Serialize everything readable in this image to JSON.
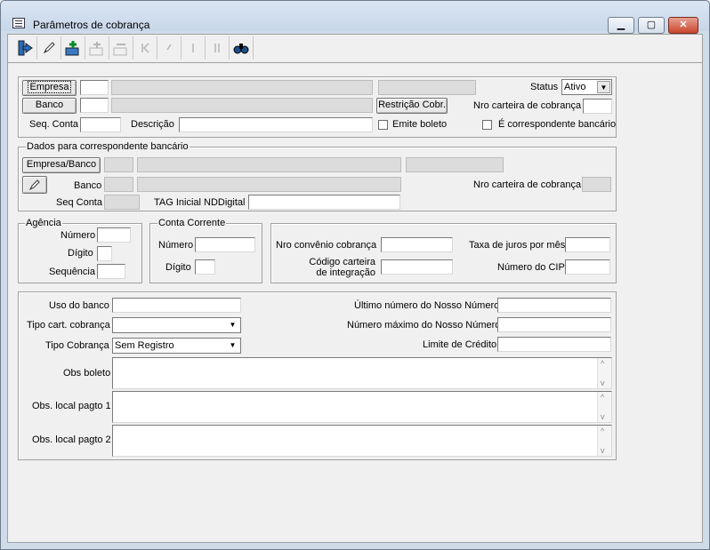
{
  "window": {
    "title": "Parâmetros de cobrança",
    "minimize": "▁",
    "maximize": "▢",
    "close": "✕"
  },
  "toolbar": {
    "icons": [
      "exit-icon",
      "edit-icon",
      "add-icon",
      "add-disabled-icon",
      "remove-disabled-icon",
      "first-icon",
      "prev-icon",
      "next-icon",
      "last-icon",
      "search-icon"
    ]
  },
  "main": {
    "empresa_button": "Empresa",
    "banco_button": "Banco",
    "restricao_button": "Restrição Cobr.",
    "status_label": "Status",
    "status_value": "Ativo",
    "nro_carteira_label": "Nro carteira de cobrança",
    "seq_conta_label": "Seq. Conta",
    "descricao_label": "Descrição",
    "emite_boleto_label": "Emite boleto",
    "correspondente_label": "É correspondente bancário"
  },
  "correspondente": {
    "title": "Dados para correspondente bancário",
    "empresa_banco_button": "Empresa/Banco",
    "banco_label": "Banco",
    "nro_carteira_label": "Nro carteira de cobrança",
    "seq_conta_label": "Seq Conta",
    "tag_label": "TAG Inicial NDDigital"
  },
  "agencia": {
    "title": "Agência",
    "numero_label": "Número",
    "digito_label": "Dígito",
    "sequencia_label": "Sequência"
  },
  "conta_corrente": {
    "title": "Conta Corrente",
    "numero_label": "Número",
    "digito_label": "Dígito"
  },
  "convenio": {
    "nro_convenio_label": "Nro convênio cobrança",
    "codigo_carteira_label_1": "Código carteira",
    "codigo_carteira_label_2": "de integração",
    "taxa_juros_label": "Taxa de juros por mês",
    "numero_cip_label": "Número do CIP"
  },
  "detalhes": {
    "uso_banco_label": "Uso do banco",
    "tipo_cart_label": "Tipo cart. cobrança",
    "tipo_cobranca_label": "Tipo Cobrança",
    "tipo_cobranca_value": "Sem Registro",
    "ultimo_nosso_numero_label": "Último número do Nosso Número",
    "numero_maximo_label": "Número máximo do Nosso Número",
    "limite_credito_label": "Limite de Crédito",
    "obs_boleto_label": "Obs boleto",
    "obs_local1_label": "Obs. local pagto 1",
    "obs_local2_label": "Obs. local pagto 2"
  }
}
